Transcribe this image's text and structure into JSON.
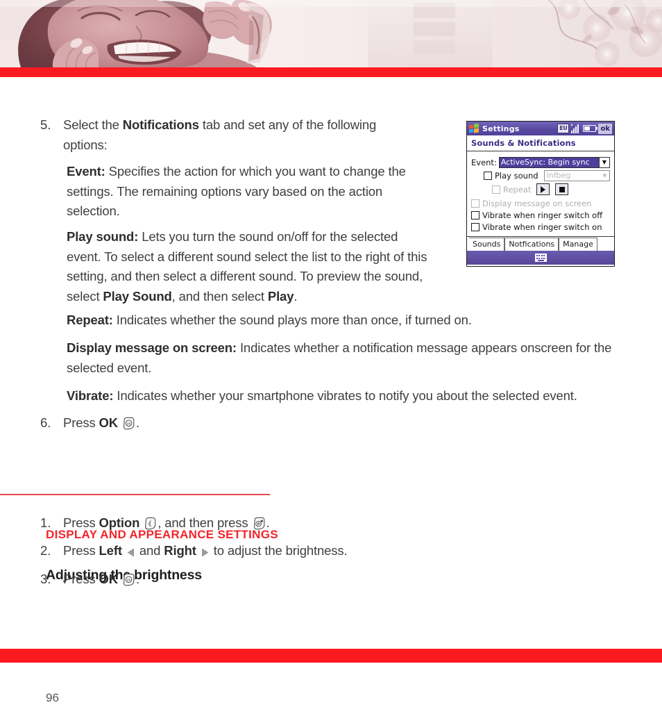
{
  "header": {
    "image_alt": "woman laughing while talking on mobile phone",
    "tint_color": "#8c4f56",
    "accent_color": "#fa1a20"
  },
  "steps": [
    {
      "number": "5.",
      "lead": "Select the ",
      "bold1": "Notifications",
      "rest": " tab and set any of the following options:"
    },
    {
      "number": "6.",
      "lead": "Press ",
      "bold1": "OK",
      "rest": "."
    }
  ],
  "definitions": [
    {
      "term": "Event:",
      "text": " Specifies the action for which you want to change the settings. The remaining options vary based on the action selection."
    },
    {
      "term": "Play sound:",
      "text_a": " Lets you turn the sound on/off for the selected event. To select a different sound select the list to the right of this setting, and then select a different sound. To preview the sound, select ",
      "bold_a": "Play Sound",
      "text_b": ", and then select ",
      "bold_b": "Play",
      "text_c": "."
    },
    {
      "term": "Repeat:",
      "text": " Indicates whether the sound plays more than once, if turned on."
    },
    {
      "term": "Display message on screen:",
      "text": " Indicates whether a notification message appears onscreen for the selected event."
    },
    {
      "term": "Vibrate:",
      "text": " Indicates whether your smartphone vibrates to notify you about the selected event."
    }
  ],
  "section": {
    "heading": "DISPLAY AND APPEARANCE SETTINGS",
    "heading_color": "#f2252b",
    "subheading": "Adjusting the brightness"
  },
  "brightness_steps": [
    {
      "number": "1.",
      "lead": "Press ",
      "bold1": "Option",
      "mid": ", and then press ",
      "rest": "."
    },
    {
      "number": "2.",
      "lead": "Press ",
      "bold1": "Left",
      "mid": " and ",
      "bold2": "Right",
      "rest": " to adjust the brightness."
    },
    {
      "number": "3.",
      "lead": "Press ",
      "bold1": "OK",
      "rest": "."
    }
  ],
  "page_number": "96",
  "pda": {
    "title": "Settings",
    "titlebar_icons": {
      "input_label": "EU",
      "signal": "signal-bars-icon",
      "battery": "battery-icon",
      "ok_label": "ok"
    },
    "subtitle": "Sounds & Notifications",
    "event_label": "Event:",
    "event_value": "ActiveSync: Begin sync",
    "play_sound_label": "Play sound",
    "sound_value": "Infbeg",
    "repeat_label": "Repeat",
    "play_button": "play-button",
    "stop_button": "stop-button",
    "display_message_label": "Display message on screen",
    "vibrate_off_label": "Vibrate when ringer switch off",
    "vibrate_on_label": "Vibrate when ringer switch on",
    "tabs": [
      {
        "label": "Sounds",
        "active": false
      },
      {
        "label": "Notfications",
        "active": true
      },
      {
        "label": "Manage",
        "active": false
      }
    ],
    "taskbar_icon": "keyboard-icon",
    "chrome_color": "#5a4aa4",
    "highlight_color": "#4e3f9e"
  }
}
